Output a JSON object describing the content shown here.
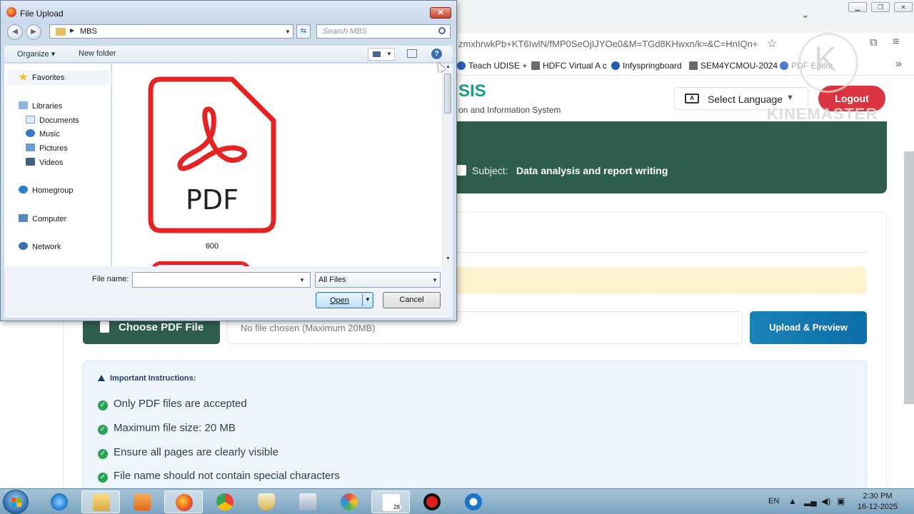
{
  "browser": {
    "url_fragment": "zmxhrwkPb+KT6IwlN/fMP0SeOjIJYOe0&M=TGd8KHwxn/k=&C=HnIQn+",
    "bookmarks": [
      "Teach UDISE +",
      "HDFC Virtual A c",
      "Infyspringboard",
      "SEM4YCMOU-2024",
      "PDF Editor"
    ]
  },
  "watermark": {
    "text": "KINEMASTER"
  },
  "page": {
    "brand": "SIS",
    "brand_sub": "on and Information System",
    "language_label": "Select Language",
    "logout_label": "Logout",
    "subject_label": "Subject:",
    "subject_value": "Data analysis and report writing",
    "choose_file_label": "Choose PDF File",
    "file_status": "No file chosen (Maximum 20MB)",
    "upload_label": "Upload & Preview",
    "instructions": {
      "heading": "Important Instructions:",
      "items": [
        "Only PDF files are accepted",
        "Maximum file size: 20 MB",
        "Ensure all pages are clearly visible",
        "File name should not contain special characters"
      ]
    }
  },
  "dialog": {
    "title": "File Upload",
    "close_label": "✕",
    "path": "MBS",
    "search_placeholder": "Search MBS",
    "organize_label": "Organize ▾",
    "new_folder_label": "New folder",
    "nav": {
      "favorites": "Favorites",
      "libraries": "Libraries",
      "documents": "Documents",
      "music": "Music",
      "pictures": "Pictures",
      "videos": "Videos",
      "homegroup": "Homegroup",
      "computer": "Computer",
      "network": "Network"
    },
    "file_item": {
      "label": "PDF",
      "name": "600"
    },
    "file_name_label": "File name:",
    "file_name_value": "",
    "filter_value": "All Files",
    "open_label": "Open",
    "cancel_label": "Cancel"
  },
  "taskbar": {
    "language": "EN",
    "time": "2:30 PM",
    "date": "16-12-2025",
    "badge": "28"
  }
}
